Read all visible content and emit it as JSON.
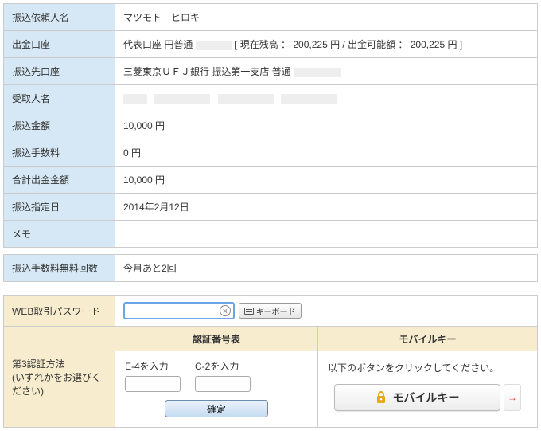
{
  "details": {
    "requester_label": "振込依頼人名",
    "requester_value": "マツモト　ヒロキ",
    "account_label": "出金口座",
    "account_prefix": "代表口座 円普通",
    "account_balance_text": "[ 現在残高 ： 200,225 円 / 出金可能額 ： 200,225 円 ]",
    "dest_label": "振込先口座",
    "dest_value": "三菱東京ＵＦＪ銀行 振込第一支店 普通",
    "payee_label": "受取人名",
    "amount_label": "振込金額",
    "amount_value": "10,000 円",
    "fee_label": "振込手数料",
    "fee_value": "0 円",
    "total_label": "合計出金金額",
    "total_value": "10,000 円",
    "date_label": "振込指定日",
    "date_value": "2014年2月12日",
    "memo_label": "メモ",
    "memo_value": ""
  },
  "free_count": {
    "label": "振込手数料無料回数",
    "value": "今月あと2回"
  },
  "password": {
    "label": "WEB取引パスワード",
    "keyboard_button": "キーボード"
  },
  "auth": {
    "side_label_1": "第3認証方法",
    "side_label_2": "(いずれかをお選びください)",
    "col_left_header": "認証番号表",
    "code1_label": "E-4を入力",
    "code2_label": "C-2を入力",
    "confirm": "確定",
    "col_right_header": "モバイルキー",
    "mobile_note": "以下のボタンをクリックしてください。",
    "mobile_button": "モバイルキー",
    "arrow": "→"
  }
}
